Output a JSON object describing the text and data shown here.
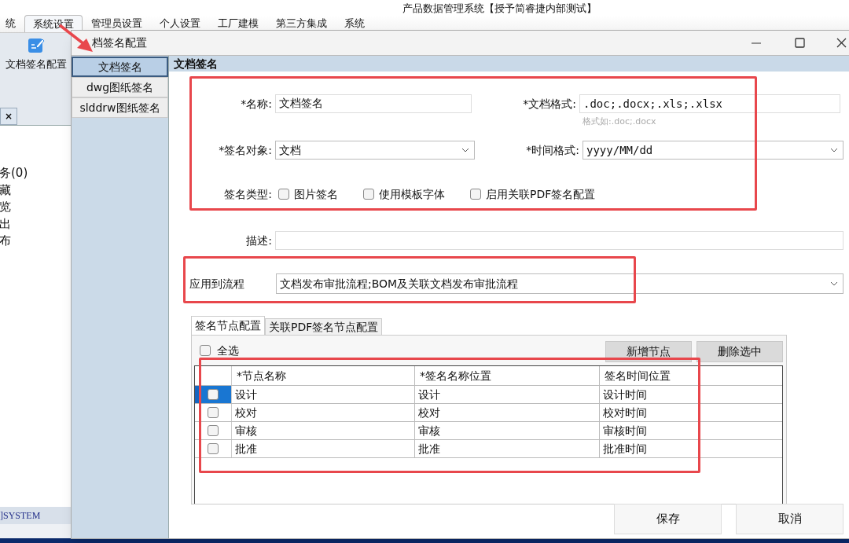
{
  "app": {
    "title": "产品数据管理系统【授予简睿捷内部测试】",
    "menu_tabs": [
      {
        "label": "统",
        "selected": false
      },
      {
        "label": "系统设置",
        "selected": true
      },
      {
        "label": "管理员设置",
        "selected": false
      },
      {
        "label": "个人设置",
        "selected": false
      },
      {
        "label": "工厂建模",
        "selected": false
      },
      {
        "label": "第三方集成",
        "selected": false
      },
      {
        "label": "系统",
        "selected": false
      }
    ],
    "ribbon_button": "文档签名配置",
    "tab_close": "×",
    "list_items": [
      "务(0)",
      "藏",
      "览",
      "出",
      "布"
    ],
    "status": "]SYSTEM"
  },
  "dialog": {
    "title": "档签名配置",
    "nav": [
      {
        "label": "文档签名",
        "selected": true
      },
      {
        "label": "dwg图纸签名",
        "selected": false
      },
      {
        "label": "slddrw图纸签名",
        "selected": false
      }
    ],
    "section_title": "文档签名",
    "name": {
      "label": "*名称:",
      "value": "文档签名"
    },
    "doc_format": {
      "label": "*文档格式:",
      "value": ".doc;.docx;.xls;.xlsx",
      "hint": "格式如:.doc;.docx"
    },
    "sign_object": {
      "label": "*签名对象:",
      "value": "文档"
    },
    "time_format": {
      "label": "*时间格式:",
      "value": "yyyy/MM/dd"
    },
    "sign_type": {
      "label": "签名类型:",
      "options": [
        {
          "label": "图片签名",
          "checked": false
        },
        {
          "label": "使用模板字体",
          "checked": false
        },
        {
          "label": "启用关联PDF签名配置",
          "checked": false
        }
      ]
    },
    "description": {
      "label": "描述:"
    },
    "workflow": {
      "label": "应用到流程",
      "value": "文档发布审批流程;BOM及关联文档发布审批流程"
    },
    "tabs": [
      {
        "label": "签名节点配置",
        "selected": true
      },
      {
        "label": "关联PDF签名节点配置",
        "selected": false
      }
    ],
    "select_all": {
      "label": "全选",
      "checked": false
    },
    "actions": [
      "新增节点",
      "删除选中"
    ],
    "table": {
      "columns": [
        "*节点名称",
        "*签名名称位置",
        "签名时间位置"
      ],
      "rows": [
        {
          "selected": true,
          "checked": false,
          "cells": [
            "设计",
            "设计",
            "设计时间"
          ]
        },
        {
          "selected": false,
          "checked": false,
          "cells": [
            "校对",
            "校对",
            "校对时间"
          ]
        },
        {
          "selected": false,
          "checked": false,
          "cells": [
            "审核",
            "审核",
            "审核时间"
          ]
        },
        {
          "selected": false,
          "checked": false,
          "cells": [
            "批准",
            "批准",
            "批准时间"
          ]
        }
      ]
    },
    "buttons": [
      "保存",
      "取消"
    ]
  }
}
